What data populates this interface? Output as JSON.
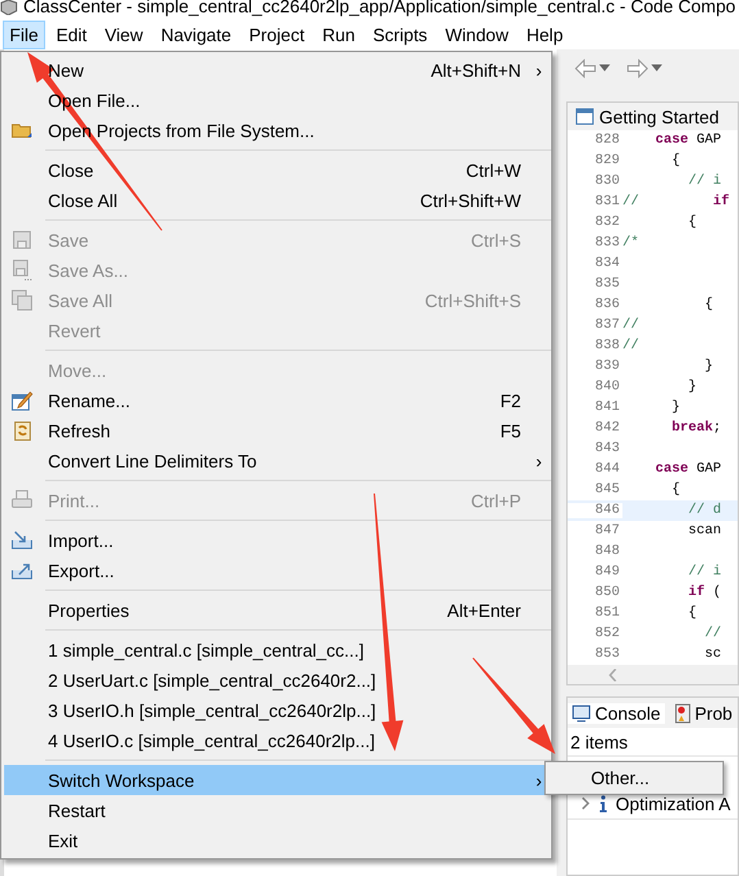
{
  "window": {
    "title": "ClassCenter - simple_central_cc2640r2lp_app/Application/simple_central.c - Code Compo"
  },
  "menubar": [
    {
      "label": "File",
      "selected": true
    },
    {
      "label": "Edit",
      "selected": false
    },
    {
      "label": "View",
      "selected": false
    },
    {
      "label": "Navigate",
      "selected": false
    },
    {
      "label": "Project",
      "selected": false
    },
    {
      "label": "Run",
      "selected": false
    },
    {
      "label": "Scripts",
      "selected": false
    },
    {
      "label": "Window",
      "selected": false
    },
    {
      "label": "Help",
      "selected": false
    }
  ],
  "file_menu": [
    {
      "kind": "plain",
      "label": "New",
      "shortcut": "Alt+Shift+N",
      "arrow": "›",
      "disabled": false,
      "selected": false
    },
    {
      "kind": "plain",
      "label": "Open File...",
      "disabled": false,
      "selected": false
    },
    {
      "kind": "folder",
      "label": "Open Projects from File System...",
      "disabled": false,
      "selected": false
    },
    {
      "kind": "separator"
    },
    {
      "kind": "plain",
      "label": "Close",
      "shortcut": "Ctrl+W",
      "disabled": false,
      "selected": false
    },
    {
      "kind": "plain",
      "label": "Close All",
      "shortcut": "Ctrl+Shift+W",
      "disabled": false,
      "selected": false
    },
    {
      "kind": "separator"
    },
    {
      "kind": "save",
      "label": "Save",
      "shortcut": "Ctrl+S",
      "disabled": true,
      "selected": false
    },
    {
      "kind": "save_as",
      "label": "Save As...",
      "disabled": true,
      "selected": false
    },
    {
      "kind": "save_all",
      "label": "Save All",
      "shortcut": "Ctrl+Shift+S",
      "disabled": true,
      "selected": false
    },
    {
      "kind": "plain",
      "label": "Revert",
      "disabled": true,
      "selected": false
    },
    {
      "kind": "separator"
    },
    {
      "kind": "plain",
      "label": "Move...",
      "disabled": true,
      "selected": false
    },
    {
      "kind": "rename",
      "label": "Rename...",
      "shortcut": "F2",
      "disabled": false,
      "selected": false
    },
    {
      "kind": "refresh",
      "label": "Refresh",
      "shortcut": "F5",
      "disabled": false,
      "selected": false
    },
    {
      "kind": "plain",
      "label": "Convert Line Delimiters To",
      "arrow": "›",
      "disabled": false,
      "selected": false
    },
    {
      "kind": "separator"
    },
    {
      "kind": "print",
      "label": "Print...",
      "shortcut": "Ctrl+P",
      "disabled": true,
      "selected": false
    },
    {
      "kind": "separator"
    },
    {
      "kind": "import",
      "label": "Import...",
      "disabled": false,
      "selected": false
    },
    {
      "kind": "export",
      "label": "Export...",
      "disabled": false,
      "selected": false
    },
    {
      "kind": "separator"
    },
    {
      "kind": "plain",
      "label": "Properties",
      "shortcut": "Alt+Enter",
      "disabled": false,
      "selected": false
    },
    {
      "kind": "separator"
    },
    {
      "kind": "plain",
      "label": "1 simple_central.c  [simple_central_cc...]",
      "disabled": false,
      "selected": false
    },
    {
      "kind": "plain",
      "label": "2 UserUart.c  [simple_central_cc2640r2...]",
      "disabled": false,
      "selected": false
    },
    {
      "kind": "plain",
      "label": "3 UserIO.h  [simple_central_cc2640r2lp...]",
      "disabled": false,
      "selected": false
    },
    {
      "kind": "plain",
      "label": "4 UserIO.c  [simple_central_cc2640r2lp...]",
      "disabled": false,
      "selected": false
    },
    {
      "kind": "separator"
    },
    {
      "kind": "plain",
      "label": "Switch Workspace",
      "arrow": "›",
      "disabled": false,
      "selected": true
    },
    {
      "kind": "plain",
      "label": "Restart",
      "disabled": false,
      "selected": false
    },
    {
      "kind": "plain",
      "label": "Exit",
      "disabled": false,
      "selected": false
    }
  ],
  "submenu": [
    {
      "label": "Other...",
      "selected": false
    }
  ],
  "editor": {
    "tab": "Getting Started",
    "lines": [
      {
        "number": "828",
        "code": [
          {
            "kind": "keyword",
            "text": "    case"
          },
          {
            "kind": "plain",
            "text": " GAP"
          }
        ]
      },
      {
        "number": "829",
        "code": [
          {
            "kind": "plain",
            "text": "      {"
          }
        ]
      },
      {
        "number": "830",
        "code": [
          {
            "kind": "comment",
            "text": "        // i"
          }
        ]
      },
      {
        "number": "831",
        "code": [
          {
            "kind": "comment",
            "text": "//"
          },
          {
            "kind": "keyword",
            "text": "         if"
          }
        ]
      },
      {
        "number": "832",
        "code": [
          {
            "kind": "plain",
            "text": "        {"
          }
        ]
      },
      {
        "number": "833",
        "code": [
          {
            "kind": "comment",
            "text": "/*"
          }
        ]
      },
      {
        "number": "834"
      },
      {
        "number": "835"
      },
      {
        "number": "836",
        "code": [
          {
            "kind": "plain",
            "text": "          {"
          }
        ]
      },
      {
        "number": "837",
        "code": [
          {
            "kind": "comment",
            "text": "//"
          }
        ]
      },
      {
        "number": "838",
        "code": [
          {
            "kind": "comment",
            "text": "//"
          }
        ]
      },
      {
        "number": "839",
        "code": [
          {
            "kind": "plain",
            "text": "          }"
          }
        ]
      },
      {
        "number": "840",
        "code": [
          {
            "kind": "plain",
            "text": "        }"
          }
        ]
      },
      {
        "number": "841",
        "code": [
          {
            "kind": "plain",
            "text": "      }"
          }
        ]
      },
      {
        "number": "842",
        "code": [
          {
            "kind": "keyword",
            "text": "      break"
          },
          {
            "kind": "plain",
            "text": ";"
          }
        ]
      },
      {
        "number": "843"
      },
      {
        "number": "844",
        "code": [
          {
            "kind": "keyword",
            "text": "    case"
          },
          {
            "kind": "plain",
            "text": " GAP"
          }
        ]
      },
      {
        "number": "845",
        "code": [
          {
            "kind": "plain",
            "text": "      {"
          }
        ]
      },
      {
        "number": "846",
        "current": true,
        "code": [
          {
            "kind": "comment",
            "text": "        // d"
          }
        ]
      },
      {
        "number": "847",
        "code": [
          {
            "kind": "plain",
            "text": "        scan"
          }
        ]
      },
      {
        "number": "848"
      },
      {
        "number": "849",
        "code": [
          {
            "kind": "comment",
            "text": "        // i"
          }
        ]
      },
      {
        "number": "850",
        "code": [
          {
            "kind": "keyword",
            "text": "        if"
          },
          {
            "kind": "plain",
            "text": " ("
          }
        ]
      },
      {
        "number": "851",
        "code": [
          {
            "kind": "plain",
            "text": "        {"
          }
        ]
      },
      {
        "number": "852",
        "code": [
          {
            "kind": "comment",
            "text": "          //"
          }
        ]
      },
      {
        "number": "853",
        "code": [
          {
            "kind": "plain",
            "text": "          sc"
          }
        ]
      }
    ]
  },
  "bottom_panel": {
    "tabs": [
      {
        "label": "Console",
        "selected": true
      },
      {
        "label": "Prob",
        "selected": false
      }
    ],
    "summary": "2 items",
    "rows": [
      {
        "label": "Optimization A",
        "expanded": false
      }
    ]
  }
}
